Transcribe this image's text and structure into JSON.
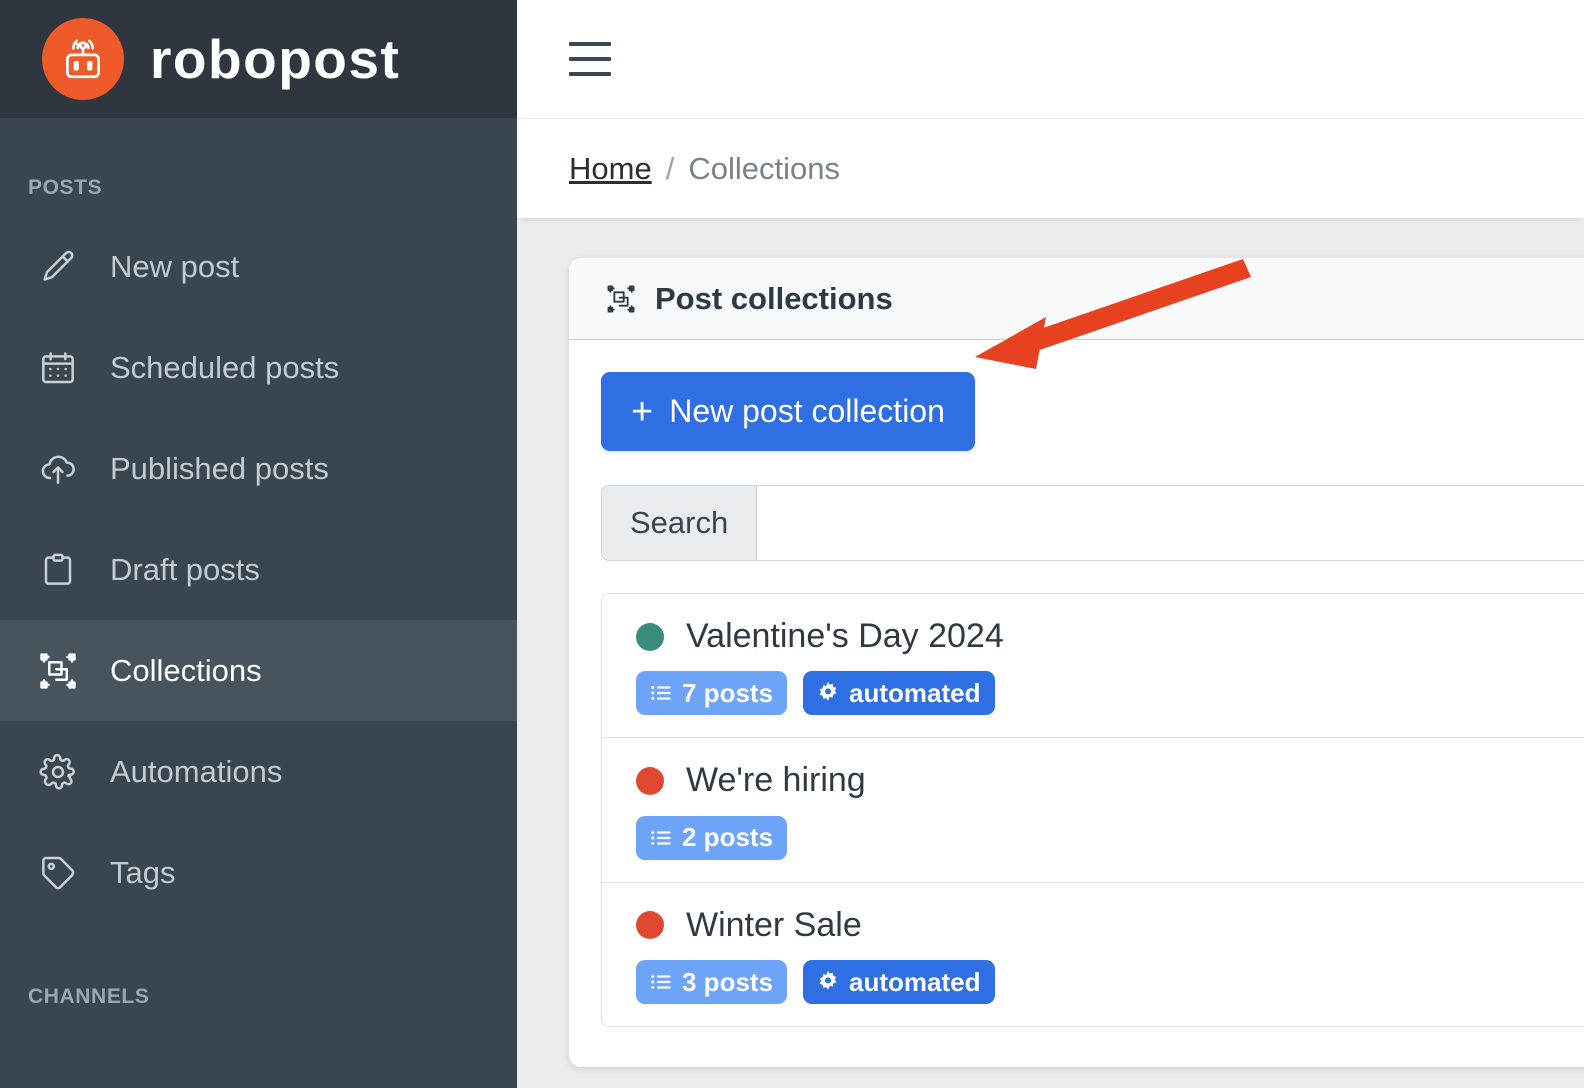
{
  "brand": {
    "name": "robopost",
    "logo_icon": "robot-broadcast-icon",
    "logo_color": "#ef5a2a"
  },
  "sidebar": {
    "sections": [
      {
        "label": "POSTS"
      },
      {
        "label": "CHANNELS"
      }
    ],
    "items": [
      {
        "label": "New post",
        "icon": "pencil-icon",
        "active": false
      },
      {
        "label": "Scheduled posts",
        "icon": "calendar-icon",
        "active": false
      },
      {
        "label": "Published posts",
        "icon": "cloud-upload-icon",
        "active": false
      },
      {
        "label": "Draft posts",
        "icon": "clipboard-icon",
        "active": false
      },
      {
        "label": "Collections",
        "icon": "collections-icon",
        "active": true
      },
      {
        "label": "Automations",
        "icon": "gear-icon",
        "active": false
      },
      {
        "label": "Tags",
        "icon": "tag-icon",
        "active": false
      }
    ]
  },
  "topbar": {
    "menu_icon": "hamburger-icon"
  },
  "breadcrumb": {
    "home": "Home",
    "separator": "/",
    "current": "Collections"
  },
  "card": {
    "icon": "collections-icon",
    "title": "Post collections",
    "new_button": {
      "plus": "+",
      "label": "New post collection"
    },
    "search": {
      "addon_label": "Search",
      "value": "",
      "placeholder": ""
    }
  },
  "collections": [
    {
      "name": "Valentine's Day 2024",
      "dot_color": "#3b8c7c",
      "badges": [
        {
          "type": "posts",
          "icon": "list-icon",
          "label": "7 posts",
          "color": "#6ea4f7"
        },
        {
          "type": "automated",
          "icon": "gear-icon",
          "label": "automated",
          "color": "#2f6fe4"
        }
      ]
    },
    {
      "name": "We're hiring",
      "dot_color": "#e0492f",
      "badges": [
        {
          "type": "posts",
          "icon": "list-icon",
          "label": "2 posts",
          "color": "#6ea4f7"
        }
      ]
    },
    {
      "name": "Winter Sale",
      "dot_color": "#e0492f",
      "badges": [
        {
          "type": "posts",
          "icon": "list-icon",
          "label": "3 posts",
          "color": "#6ea4f7"
        },
        {
          "type": "automated",
          "icon": "gear-icon",
          "label": "automated",
          "color": "#2f6fe4"
        }
      ]
    }
  ],
  "annotation": {
    "type": "arrow",
    "color": "#e8411f",
    "points_at": "new-post-collection-button"
  },
  "theme": {
    "sidebar_bg": "#39454f",
    "sidebar_active_bg": "#47545e",
    "brand_bar_bg": "#2f3640",
    "page_bg": "#eaebed",
    "primary": "#2f6fe4",
    "card_header_bg": "#f8f9fa"
  }
}
